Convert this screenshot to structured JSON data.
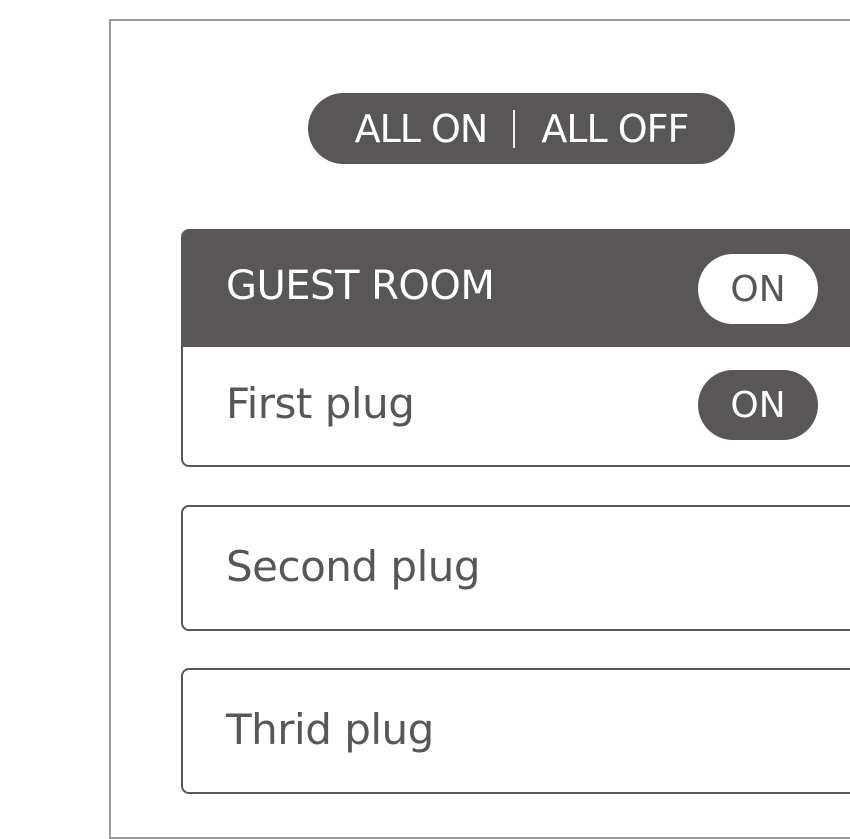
{
  "controls": {
    "all_on_label": "ALL ON",
    "all_off_label": "ALL OFF"
  },
  "rooms": [
    {
      "name": "GUEST ROOM",
      "toggle_label": "ON",
      "plugs": [
        {
          "label": "First plug",
          "toggle_label": "ON"
        }
      ]
    }
  ],
  "standalone_plugs": [
    {
      "label": "Second plug"
    },
    {
      "label": "Thrid plug"
    }
  ],
  "colors": {
    "primary": "#585657",
    "border": "#9a9a9a",
    "background": "#ffffff"
  }
}
